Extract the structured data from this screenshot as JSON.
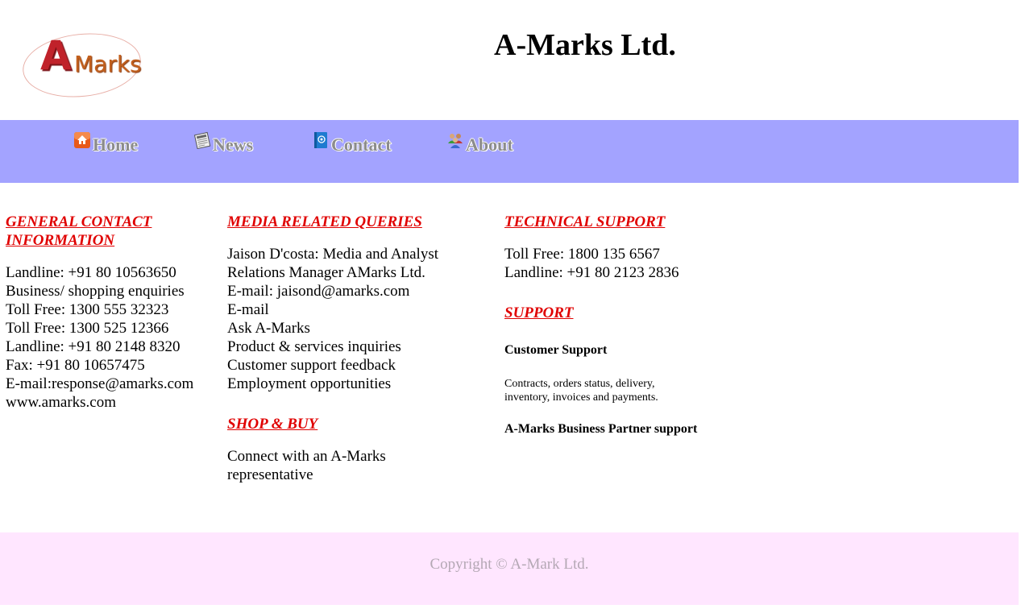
{
  "header": {
    "logo": {
      "letter": "A",
      "word": "Marks"
    },
    "title": "A-Marks Ltd."
  },
  "nav": {
    "items": [
      {
        "label": "Home",
        "icon": "home-icon"
      },
      {
        "label": "News",
        "icon": "newspaper-icon"
      },
      {
        "label": "Contact",
        "icon": "address-book-icon"
      },
      {
        "label": "About",
        "icon": "people-icon"
      }
    ]
  },
  "general_contact": {
    "heading": "GENERAL CONTACT INFORMATION",
    "lines": [
      "Landline: +91 80 10563650",
      "Business/ shopping enquiries",
      "Toll Free: 1300 555 32323",
      "Toll Free: 1300 525 12366",
      "Landline: +91 80 2148 8320",
      "Fax: +91 80 10657475",
      "E-mail:response@amarks.com",
      "www.amarks.com"
    ]
  },
  "media": {
    "heading": "MEDIA RELATED QUERIES",
    "intro": "Jaison D'costa: Media and Analyst Relations Manager AMarks Ltd.",
    "lines": [
      "E-mail: jaisond@amarks.com",
      "E-mail",
      "Ask A-Marks",
      "Product & services inquiries",
      "Customer support feedback",
      "Employment opportunities"
    ]
  },
  "shop": {
    "heading": "SHOP & BUY",
    "text": "Connect with an A-Marks representative"
  },
  "technical": {
    "heading": "TECHNICAL SUPPORT",
    "lines": [
      "Toll Free: 1800 135 6567",
      "Landline: +91 80 2123 2836"
    ]
  },
  "support": {
    "heading": "SUPPORT",
    "customer_title": "Customer Support",
    "customer_text": "Contracts, orders status, delivery, inventory, invoices and payments.",
    "partner_title": "A-Marks Business Partner support"
  },
  "footer": {
    "copyright": "Copyright © A-Mark Ltd."
  },
  "colors": {
    "nav_bg": "#a3a3ff",
    "heading": "#e00000",
    "footer_bg": "#ffe6ff"
  }
}
